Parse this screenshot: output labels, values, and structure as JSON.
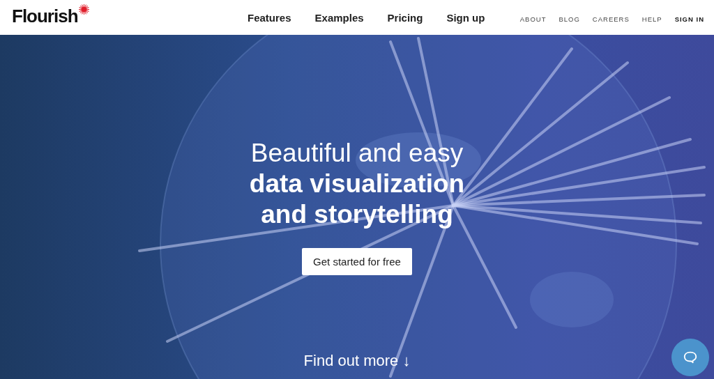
{
  "header": {
    "logo": "Flourish",
    "main_nav": [
      {
        "label": "Features"
      },
      {
        "label": "Examples"
      },
      {
        "label": "Pricing"
      },
      {
        "label": "Sign up"
      }
    ],
    "secondary_nav": [
      {
        "label": "ABOUT",
        "emphasis": false
      },
      {
        "label": "BLOG",
        "emphasis": false
      },
      {
        "label": "CAREERS",
        "emphasis": false
      },
      {
        "label": "HELP",
        "emphasis": false
      },
      {
        "label": "SIGN IN",
        "emphasis": true
      }
    ]
  },
  "hero": {
    "headline": [
      "Beautiful and easy",
      "**data visualization**",
      "**and storytelling**"
    ],
    "cta_button": "Get started for free",
    "find_out_more": "Find out more ↓"
  }
}
